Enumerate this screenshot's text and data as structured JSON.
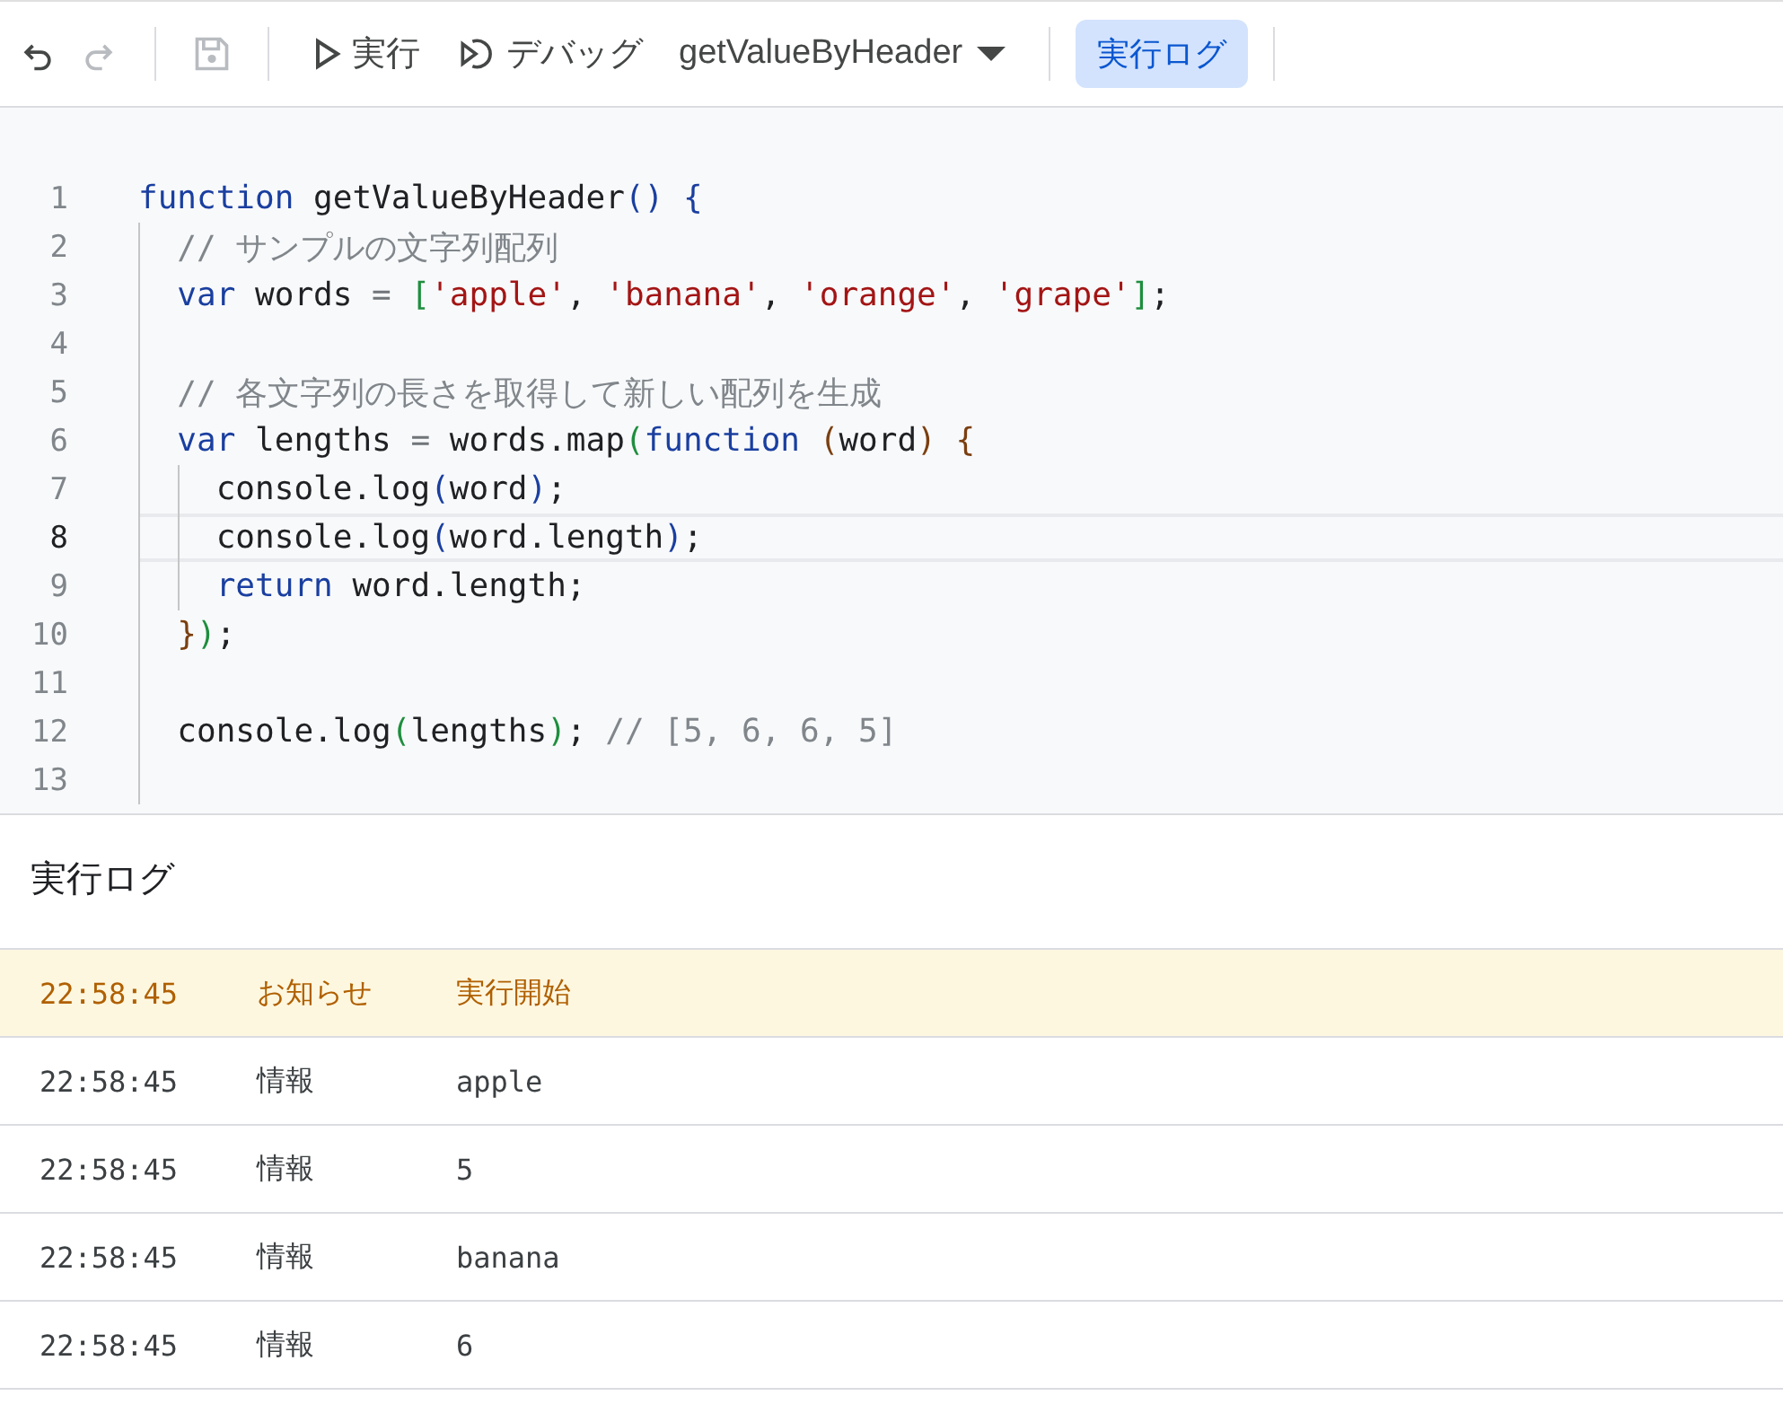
{
  "toolbar": {
    "undo": {
      "disabled": false
    },
    "redo": {
      "disabled": true
    },
    "save": {
      "disabled": true
    },
    "run": {
      "label": "実行"
    },
    "debug": {
      "label": "デバッグ"
    },
    "function_select": {
      "value": "getValueByHeader"
    },
    "log_toggle": {
      "label": "実行ログ",
      "selected": true
    }
  },
  "editor": {
    "lines": [
      {
        "number": "1",
        "current": false,
        "tokens": [
          {
            "kind": "keyword",
            "text": "function"
          },
          {
            "kind": "plain",
            "text": " getValueByHeader"
          },
          {
            "kind": "bracket1",
            "text": "()"
          },
          {
            "kind": "bracket1",
            "text": " {"
          }
        ],
        "children": [
          {
            "number": "2",
            "current": false,
            "tokens": [
              {
                "kind": "comment",
                "text": "// サンプルの文字列配列"
              }
            ]
          },
          {
            "number": "3",
            "current": false,
            "tokens": [
              {
                "kind": "keyword",
                "text": "var"
              },
              {
                "kind": "plain",
                "text": " words "
              },
              {
                "kind": "operator",
                "text": "="
              },
              {
                "kind": "bracket2",
                "text": " ["
              },
              {
                "kind": "string",
                "text": "'apple'"
              },
              {
                "kind": "plain",
                "text": ", "
              },
              {
                "kind": "string",
                "text": "'banana'"
              },
              {
                "kind": "plain",
                "text": ", "
              },
              {
                "kind": "string",
                "text": "'orange'"
              },
              {
                "kind": "plain",
                "text": ", "
              },
              {
                "kind": "string",
                "text": "'grape'"
              },
              {
                "kind": "bracket2",
                "text": "]"
              },
              {
                "kind": "plain",
                "text": ";"
              }
            ]
          },
          {
            "number": "4",
            "current": false
          },
          {
            "number": "5",
            "current": false,
            "tokens": [
              {
                "kind": "comment",
                "text": "// 各文字列の長さを取得して新しい配列を生成"
              }
            ]
          },
          {
            "number": "6",
            "current": false,
            "tokens": [
              {
                "kind": "keyword",
                "text": "var"
              },
              {
                "kind": "plain",
                "text": " lengths "
              },
              {
                "kind": "operator",
                "text": "="
              },
              {
                "kind": "plain",
                "text": " words.map"
              },
              {
                "kind": "bracket2",
                "text": "("
              },
              {
                "kind": "keyword",
                "text": "function"
              },
              {
                "kind": "bracket3",
                "text": " ("
              },
              {
                "kind": "plain",
                "text": "word"
              },
              {
                "kind": "bracket3",
                "text": ")"
              },
              {
                "kind": "bracket3",
                "text": " {"
              }
            ],
            "children": [
              {
                "number": "7",
                "current": false,
                "tokens": [
                  {
                    "kind": "plain",
                    "text": "console.log"
                  },
                  {
                    "kind": "bracket1",
                    "text": "("
                  },
                  {
                    "kind": "plain",
                    "text": "word"
                  },
                  {
                    "kind": "bracket1",
                    "text": ")"
                  },
                  {
                    "kind": "plain",
                    "text": ";"
                  }
                ]
              },
              {
                "number": "8",
                "current": true,
                "tokens": [
                  {
                    "kind": "plain",
                    "text": "console.log"
                  },
                  {
                    "kind": "bracket1",
                    "text": "("
                  },
                  {
                    "kind": "plain",
                    "text": "word.length"
                  },
                  {
                    "kind": "bracket1",
                    "text": ")"
                  },
                  {
                    "kind": "plain",
                    "text": ";"
                  }
                ]
              },
              {
                "number": "9",
                "current": false,
                "tokens": [
                  {
                    "kind": "keyword",
                    "text": "return"
                  },
                  {
                    "kind": "plain",
                    "text": " word.length;"
                  }
                ]
              }
            ]
          },
          {
            "number": "10",
            "current": false,
            "tokens": [
              {
                "kind": "bracket3",
                "text": "}"
              },
              {
                "kind": "bracket2",
                "text": ")"
              },
              {
                "kind": "plain",
                "text": ";"
              }
            ]
          },
          {
            "number": "11",
            "current": false
          },
          {
            "number": "12",
            "current": false,
            "tokens": [
              {
                "kind": "plain",
                "text": "console.log"
              },
              {
                "kind": "bracket2",
                "text": "("
              },
              {
                "kind": "plain",
                "text": "lengths"
              },
              {
                "kind": "bracket2",
                "text": ")"
              },
              {
                "kind": "plain",
                "text": "; "
              },
              {
                "kind": "comment",
                "text": "// [5, 6, 6, 5]"
              }
            ]
          },
          {
            "number": "13",
            "current": false
          }
        ]
      }
    ]
  },
  "log": {
    "title": "実行ログ",
    "rows": [
      {
        "kind": "notice",
        "time": "22:58:45",
        "level": "お知らせ",
        "message": "実行開始"
      },
      {
        "kind": "info",
        "time": "22:58:45",
        "level": "情報",
        "message": "apple"
      },
      {
        "kind": "info",
        "time": "22:58:45",
        "level": "情報",
        "message": "5"
      },
      {
        "kind": "info",
        "time": "22:58:45",
        "level": "情報",
        "message": "banana"
      },
      {
        "kind": "info",
        "time": "22:58:45",
        "level": "情報",
        "message": "6"
      }
    ]
  }
}
